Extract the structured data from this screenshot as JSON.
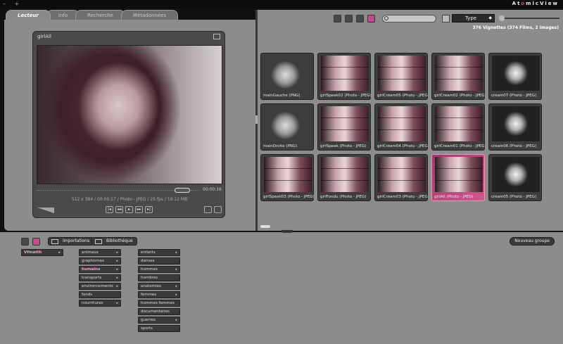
{
  "titlebar": {
    "brand_a": "At",
    "brand_b": "o",
    "brand_c": "micView",
    "win_controls": "– +"
  },
  "tabs": [
    {
      "label": "Lecteur",
      "active": true
    },
    {
      "label": "Info"
    },
    {
      "label": "Recherche"
    },
    {
      "label": "Métadonnées"
    }
  ],
  "player": {
    "title": "girlAll",
    "time": "00:00:16",
    "meta": "512 x 384 / 00:00:17 / Photo - JPEG / 25 fps / 19.12 MB",
    "controls": [
      "|◂",
      "◂◂",
      "▸",
      "▸▸",
      "▸|"
    ],
    "progress": 0.9
  },
  "toolbar": {
    "buttons": [
      "grid-icon",
      "lock-icon",
      "list-icon",
      "color-icon"
    ],
    "search_placeholder": "",
    "type_label": "Type"
  },
  "count_text": "376 Vignettes  (374 Films, 2 Images)",
  "thumbs": [
    {
      "label": "mainGauche (PNG)",
      "kind": "hand"
    },
    {
      "label": "girlSpeak02 (Photo - JPEG)",
      "kind": "face"
    },
    {
      "label": "girlCream05 (Photo - JPEG)",
      "kind": "face"
    },
    {
      "label": "girlCream02 (Photo - JPEG)",
      "kind": "face"
    },
    {
      "label": "cream07 (Photo - JPEG)",
      "kind": "cream"
    },
    {
      "label": "mainDroite (PNG)",
      "kind": "hand"
    },
    {
      "label": "girlSpeak (Photo - JPEG)",
      "kind": "face"
    },
    {
      "label": "girlCream04 (Photo - JPEG)",
      "kind": "face"
    },
    {
      "label": "girlCream01 (Photo - JPEG)",
      "kind": "face"
    },
    {
      "label": "cream06 (Photo - JPEG)",
      "kind": "cream"
    },
    {
      "label": "girlSpeak03 (Photo - JPEG)",
      "kind": "face"
    },
    {
      "label": "girlFondu (Photo - JPEG)",
      "kind": "face"
    },
    {
      "label": "girlCream03 (Photo - JPEG)",
      "kind": "face"
    },
    {
      "label": "girlAll (Photo - JPEG)",
      "kind": "face",
      "selected": true
    },
    {
      "label": "cream05 (Photo - JPEG)",
      "kind": "cream"
    }
  ],
  "bottom": {
    "importations": "Importations",
    "bibliotheque": "Bibliothèque",
    "new_group": "Nouveau groupe",
    "col1": [
      {
        "label": "Vfmatth",
        "chev": true,
        "sel": true
      }
    ],
    "col2": [
      {
        "label": "animaux",
        "chev": true
      },
      {
        "label": "graphismes",
        "chev": true
      },
      {
        "label": "humains",
        "chev": true,
        "sel": true
      },
      {
        "label": "transports",
        "chev": true
      },
      {
        "label": "environnements",
        "chev": true
      },
      {
        "label": "fonds"
      },
      {
        "label": "nourritures",
        "chev": true
      }
    ],
    "col3": [
      {
        "label": "enfants",
        "chev": true
      },
      {
        "label": "danses"
      },
      {
        "label": "hommes",
        "chev": true
      },
      {
        "label": "hombres"
      },
      {
        "label": "anatomies",
        "chev": true
      },
      {
        "label": "femmes",
        "chev": true
      },
      {
        "label": "hommes femmes"
      },
      {
        "label": "documentaires"
      },
      {
        "label": "guerres",
        "chev": true
      },
      {
        "label": "sports"
      }
    ]
  }
}
